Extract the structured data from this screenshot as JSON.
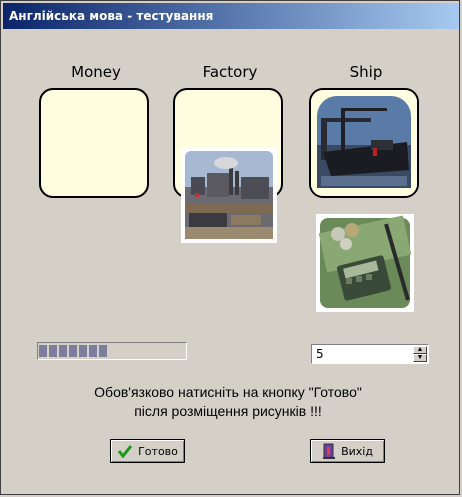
{
  "window": {
    "title": "Англійська мова - тестування"
  },
  "targets": [
    {
      "label": "Money"
    },
    {
      "label": "Factory"
    },
    {
      "label": "Ship"
    }
  ],
  "images": [
    {
      "name": "factory-image",
      "subject": "factory"
    },
    {
      "name": "ship-image",
      "subject": "ship"
    },
    {
      "name": "money-image",
      "subject": "money"
    }
  ],
  "progress": {
    "segments": 10,
    "filled_fraction": 0.67
  },
  "spinner": {
    "value": "5"
  },
  "message": {
    "line1": "Обов'язково натисніть на кнопку \"Готово\"",
    "line2": "після розміщення рисунків !!!"
  },
  "buttons": {
    "done_label": "Готово",
    "exit_label": "Вихід",
    "done_icon": "check-icon",
    "exit_icon": "exit-door-icon"
  },
  "colors": {
    "slot_fill": "#fffde0",
    "title_start": "#0a246a",
    "title_end": "#a6caf0"
  }
}
